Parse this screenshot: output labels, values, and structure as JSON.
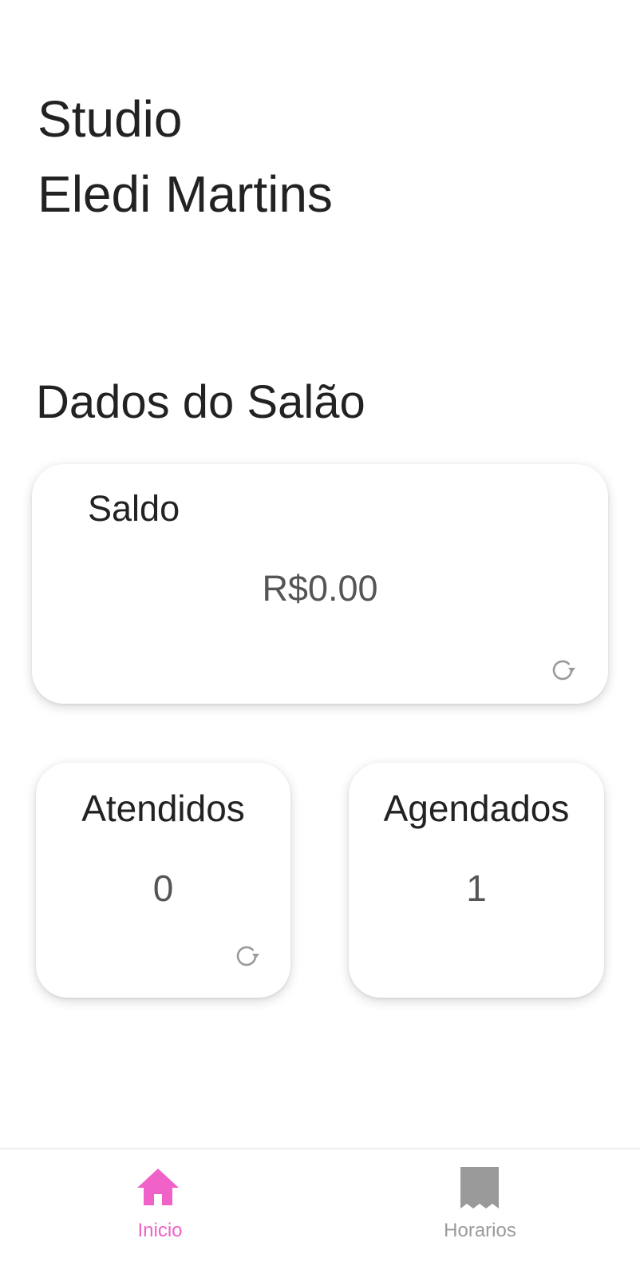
{
  "header": {
    "title_line1": "Studio",
    "title_line2": "Eledi Martins"
  },
  "section": {
    "title": "Dados do Salão"
  },
  "saldo_card": {
    "label": "Saldo",
    "value": "R$0.00",
    "refresh_icon": "refresh-icon"
  },
  "atendidos_card": {
    "label": "Atendidos",
    "value": "0",
    "refresh_icon": "refresh-icon"
  },
  "agendados_card": {
    "label": "Agendados",
    "value": "1"
  },
  "bottom_nav": {
    "items": [
      {
        "label": "Inicio",
        "icon": "home-icon",
        "active": true,
        "color": "#f062c8"
      },
      {
        "label": "Horarios",
        "icon": "receipt-icon",
        "active": false,
        "color": "#9a9a9a"
      }
    ]
  },
  "colors": {
    "accent": "#f062c8",
    "inactive": "#9a9a9a",
    "text": "#222222",
    "value_text": "#555555"
  }
}
